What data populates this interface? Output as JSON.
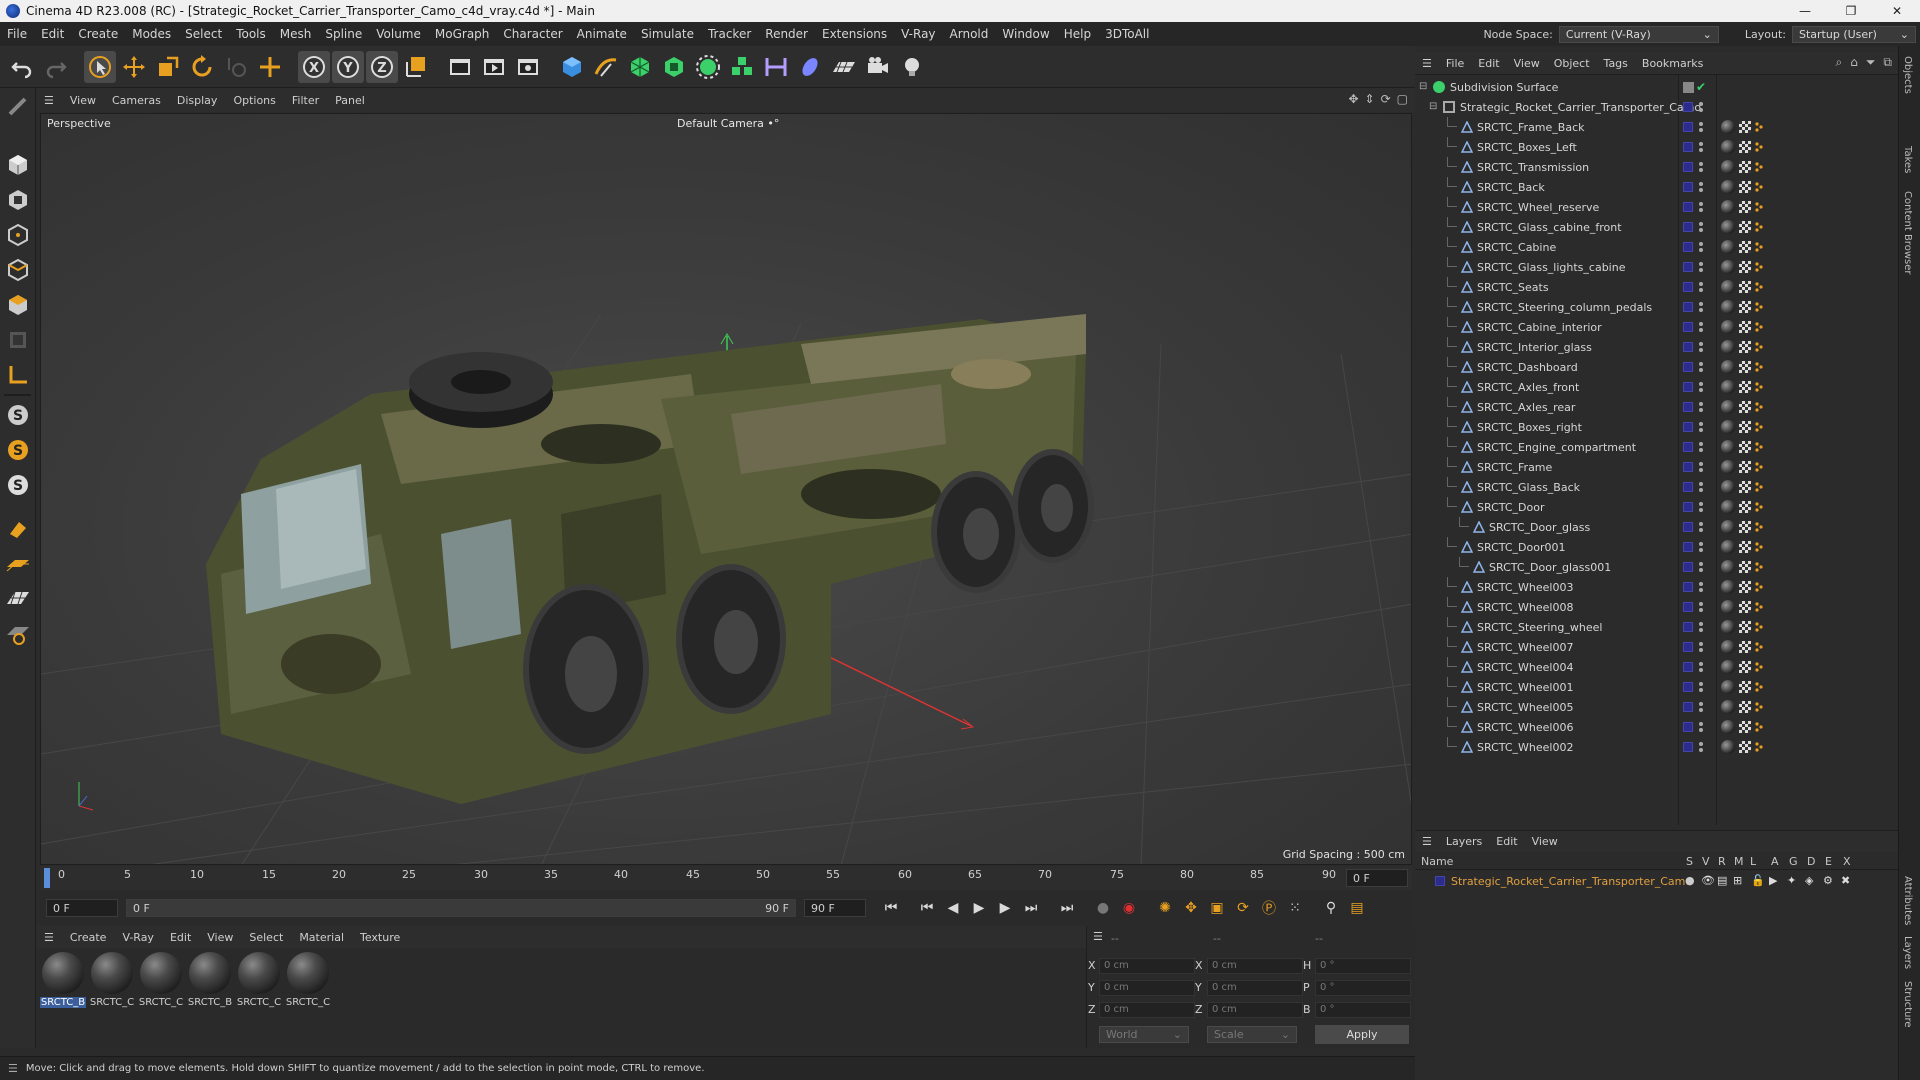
{
  "window": {
    "title": "Cinema 4D R23.008 (RC) - [Strategic_Rocket_Carrier_Transporter_Camo_c4d_vray.c4d *] - Main",
    "controls": [
      "—",
      "❐",
      "✕"
    ]
  },
  "menubar": {
    "items": [
      "File",
      "Edit",
      "Create",
      "Modes",
      "Select",
      "Tools",
      "Mesh",
      "Spline",
      "Volume",
      "MoGraph",
      "Character",
      "Animate",
      "Simulate",
      "Tracker",
      "Render",
      "Extensions",
      "V-Ray",
      "Arnold",
      "Window",
      "Help",
      "3DToAll"
    ],
    "node_space_label": "Node Space:",
    "node_space_value": "Current (V-Ray)",
    "layout_label": "Layout:",
    "layout_value": "Startup (User)"
  },
  "toolbar": {
    "icons": [
      "undo-icon",
      "redo-icon",
      "select-icon",
      "move-icon",
      "scale-icon",
      "rotate-icon",
      "live-select-icon",
      "create-icon",
      "x-axis-icon",
      "y-axis-icon",
      "z-axis-icon",
      "coordinate-system-icon",
      "render-region-icon",
      "render-view-icon",
      "render-settings-icon",
      "cube-icon",
      "pen-icon",
      "subdivision-icon",
      "extrude-icon",
      "cloner-icon",
      "mograph-icon",
      "deformer-icon",
      "field-icon",
      "floor-icon",
      "camera-icon",
      "light-icon"
    ]
  },
  "viewport": {
    "menu": [
      "View",
      "Cameras",
      "Display",
      "Options",
      "Filter",
      "Panel"
    ],
    "label": "Perspective",
    "camera": "Default Camera",
    "camera_suffix": "•°",
    "grid_spacing": "Grid Spacing : 500 cm"
  },
  "timeline": {
    "ticks": [
      "0",
      "5",
      "10",
      "15",
      "20",
      "25",
      "30",
      "35",
      "40",
      "45",
      "50",
      "55",
      "60",
      "65",
      "70",
      "75",
      "80",
      "85",
      "90"
    ],
    "current_frame": "0 F",
    "start_field": "0 F",
    "range_start": "0 F",
    "range_end": "90 F",
    "end_field": "90 F"
  },
  "materials": {
    "menu": [
      "Create",
      "V-Ray",
      "Edit",
      "View",
      "Select",
      "Material",
      "Texture"
    ],
    "items": [
      "SRCTC_B",
      "SRCTC_C",
      "SRCTC_C",
      "SRCTC_B",
      "SRCTC_C",
      "SRCTC_C"
    ]
  },
  "coords": {
    "header": [
      "--",
      "--",
      "--"
    ],
    "rows": [
      {
        "a": "X",
        "av": "0 cm",
        "b": "X",
        "bv": "0 cm",
        "c": "H",
        "cv": "0 °"
      },
      {
        "a": "Y",
        "av": "0 cm",
        "b": "Y",
        "bv": "0 cm",
        "c": "P",
        "cv": "0 °"
      },
      {
        "a": "Z",
        "av": "0 cm",
        "b": "Z",
        "bv": "0 cm",
        "c": "B",
        "cv": "0 °"
      }
    ],
    "world": "World",
    "scale": "Scale",
    "apply": "Apply"
  },
  "status": {
    "text": "Move: Click and drag to move elements. Hold down SHIFT to quantize movement / add to the selection in point mode, CTRL to remove."
  },
  "objects": {
    "menu": [
      "File",
      "Edit",
      "View",
      "Object",
      "Tags",
      "Bookmarks"
    ],
    "root": "Subdivision Surface",
    "group": "Strategic_Rocket_Carrier_Transporter_Camo",
    "items": [
      {
        "name": "SRCTC_Frame_Back",
        "depth": 2
      },
      {
        "name": "SRCTC_Boxes_Left",
        "depth": 2
      },
      {
        "name": "SRCTC_Transmission",
        "depth": 2
      },
      {
        "name": "SRCTC_Back",
        "depth": 2
      },
      {
        "name": "SRCTC_Wheel_reserve",
        "depth": 2
      },
      {
        "name": "SRCTC_Glass_cabine_front",
        "depth": 2
      },
      {
        "name": "SRCTC_Cabine",
        "depth": 2
      },
      {
        "name": "SRCTC_Glass_lights_cabine",
        "depth": 2
      },
      {
        "name": "SRCTC_Seats",
        "depth": 2
      },
      {
        "name": "SRCTC_Steering_column_pedals",
        "depth": 2
      },
      {
        "name": "SRCTC_Cabine_interior",
        "depth": 2
      },
      {
        "name": "SRCTC_Interior_glass",
        "depth": 2
      },
      {
        "name": "SRCTC_Dashboard",
        "depth": 2
      },
      {
        "name": "SRCTC_Axles_front",
        "depth": 2
      },
      {
        "name": "SRCTC_Axles_rear",
        "depth": 2
      },
      {
        "name": "SRCTC_Boxes_right",
        "depth": 2
      },
      {
        "name": "SRCTC_Engine_compartment",
        "depth": 2
      },
      {
        "name": "SRCTC_Frame",
        "depth": 2
      },
      {
        "name": "SRCTC_Glass_Back",
        "depth": 2
      },
      {
        "name": "SRCTC_Door",
        "depth": 2
      },
      {
        "name": "SRCTC_Door_glass",
        "depth": 3
      },
      {
        "name": "SRCTC_Door001",
        "depth": 2
      },
      {
        "name": "SRCTC_Door_glass001",
        "depth": 3
      },
      {
        "name": "SRCTC_Wheel003",
        "depth": 2
      },
      {
        "name": "SRCTC_Wheel008",
        "depth": 2
      },
      {
        "name": "SRCTC_Steering_wheel",
        "depth": 2
      },
      {
        "name": "SRCTC_Wheel007",
        "depth": 2
      },
      {
        "name": "SRCTC_Wheel004",
        "depth": 2
      },
      {
        "name": "SRCTC_Wheel001",
        "depth": 2
      },
      {
        "name": "SRCTC_Wheel005",
        "depth": 2
      },
      {
        "name": "SRCTC_Wheel006",
        "depth": 2
      },
      {
        "name": "SRCTC_Wheel002",
        "depth": 2
      }
    ]
  },
  "layers": {
    "menu": [
      "Layers",
      "Edit",
      "View"
    ],
    "columns": [
      "Name",
      "S",
      "V",
      "R",
      "M",
      "L",
      "A",
      "G",
      "D",
      "E",
      "X"
    ],
    "layer_name": "Strategic_Rocket_Carrier_Transporter_Camo"
  },
  "vtabs": [
    "Objects",
    "Takes",
    "Content Browser",
    "Attributes",
    "Layers",
    "Structure"
  ],
  "colors": {
    "accent": "#5b8fd9",
    "layer_name": "#e0a040",
    "layer_swatch": "#2c2c8f"
  }
}
